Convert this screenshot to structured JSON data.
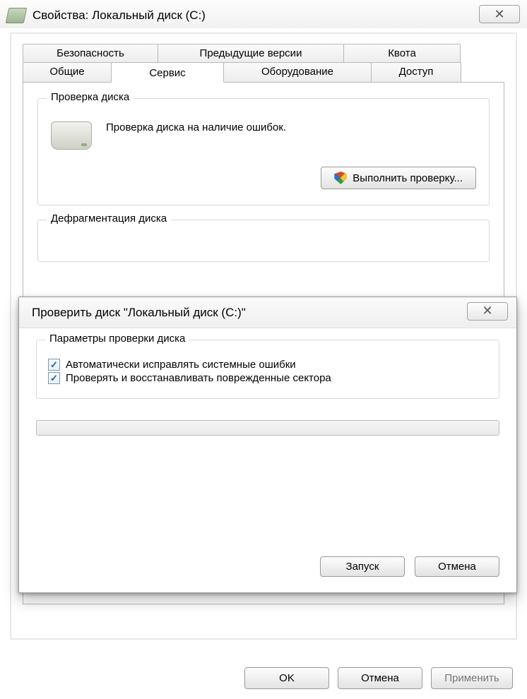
{
  "window": {
    "title": "Свойства: Локальный диск (C:)",
    "close_glyph": "✕"
  },
  "tabs_row1": [
    "Безопасность",
    "Предыдущие версии",
    "Квота"
  ],
  "tabs_row2": [
    "Общие",
    "Сервис",
    "Оборудование",
    "Доступ"
  ],
  "group_check": {
    "title": "Проверка диска",
    "desc": "Проверка диска на наличие ошибок.",
    "button": "Выполнить проверку..."
  },
  "group_defrag": {
    "title": "Дефрагментация диска"
  },
  "check_dialog": {
    "title": "Проверить диск \"Локальный диск (C:)\"",
    "group_title": "Параметры проверки диска",
    "opt1": "Автоматически исправлять системные ошибки",
    "opt2": "Проверять и восстанавливать поврежденные сектора",
    "start": "Запуск",
    "cancel": "Отмена",
    "close_glyph": "✕"
  },
  "buttons": {
    "ok": "OK",
    "cancel": "Отмена",
    "apply": "Применить"
  }
}
